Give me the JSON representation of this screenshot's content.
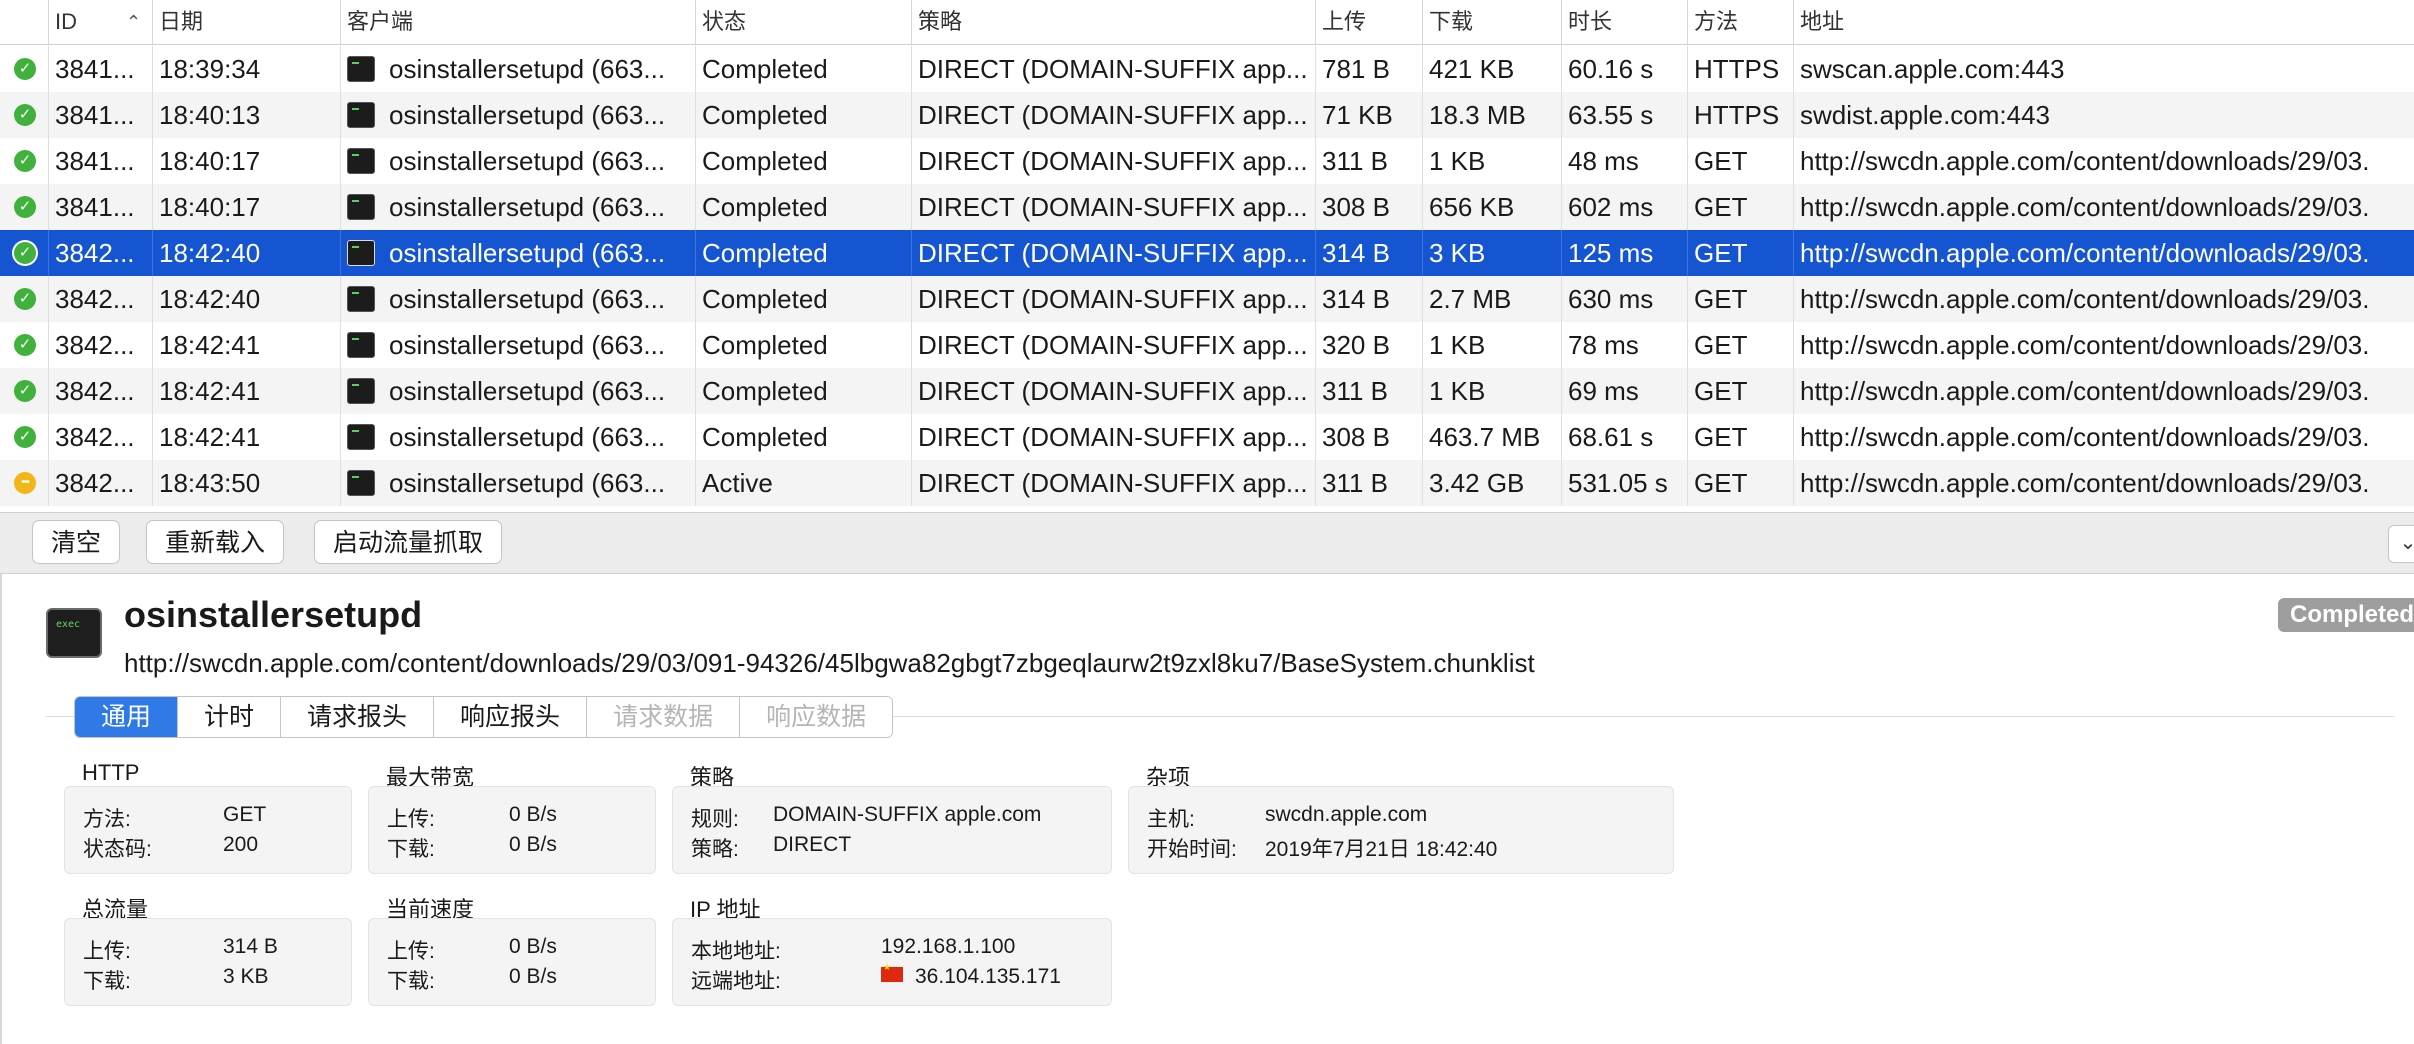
{
  "table": {
    "columns": [
      "ID",
      "日期",
      "客户端",
      "状态",
      "策略",
      "上传",
      "下载",
      "时长",
      "方法",
      "地址"
    ],
    "rows": [
      {
        "status": "done",
        "id": "3841...",
        "time": "18:39:34",
        "client": "osinstallersetupd (663...",
        "state": "Completed",
        "policy": "DIRECT (DOMAIN-SUFFIX app...",
        "upload": "781 B",
        "download": "421 KB",
        "duration": "60.16 s",
        "method": "HTTPS",
        "address": "swscan.apple.com:443"
      },
      {
        "status": "done",
        "id": "3841...",
        "time": "18:40:13",
        "client": "osinstallersetupd (663...",
        "state": "Completed",
        "policy": "DIRECT (DOMAIN-SUFFIX app...",
        "upload": "71 KB",
        "download": "18.3 MB",
        "duration": "63.55 s",
        "method": "HTTPS",
        "address": "swdist.apple.com:443"
      },
      {
        "status": "done",
        "id": "3841...",
        "time": "18:40:17",
        "client": "osinstallersetupd (663...",
        "state": "Completed",
        "policy": "DIRECT (DOMAIN-SUFFIX app...",
        "upload": "311 B",
        "download": "1 KB",
        "duration": "48 ms",
        "method": "GET",
        "address": "http://swcdn.apple.com/content/downloads/29/03."
      },
      {
        "status": "done",
        "id": "3841...",
        "time": "18:40:17",
        "client": "osinstallersetupd (663...",
        "state": "Completed",
        "policy": "DIRECT (DOMAIN-SUFFIX app...",
        "upload": "308 B",
        "download": "656 KB",
        "duration": "602 ms",
        "method": "GET",
        "address": "http://swcdn.apple.com/content/downloads/29/03."
      },
      {
        "status": "done",
        "id": "3842...",
        "time": "18:42:40",
        "client": "osinstallersetupd (663...",
        "state": "Completed",
        "policy": "DIRECT (DOMAIN-SUFFIX app...",
        "upload": "314 B",
        "download": "3 KB",
        "duration": "125 ms",
        "method": "GET",
        "address": "http://swcdn.apple.com/content/downloads/29/03.",
        "selected": true
      },
      {
        "status": "done",
        "id": "3842...",
        "time": "18:42:40",
        "client": "osinstallersetupd (663...",
        "state": "Completed",
        "policy": "DIRECT (DOMAIN-SUFFIX app...",
        "upload": "314 B",
        "download": "2.7 MB",
        "duration": "630 ms",
        "method": "GET",
        "address": "http://swcdn.apple.com/content/downloads/29/03."
      },
      {
        "status": "done",
        "id": "3842...",
        "time": "18:42:41",
        "client": "osinstallersetupd (663...",
        "state": "Completed",
        "policy": "DIRECT (DOMAIN-SUFFIX app...",
        "upload": "320 B",
        "download": "1 KB",
        "duration": "78 ms",
        "method": "GET",
        "address": "http://swcdn.apple.com/content/downloads/29/03."
      },
      {
        "status": "done",
        "id": "3842...",
        "time": "18:42:41",
        "client": "osinstallersetupd (663...",
        "state": "Completed",
        "policy": "DIRECT (DOMAIN-SUFFIX app...",
        "upload": "311 B",
        "download": "1 KB",
        "duration": "69 ms",
        "method": "GET",
        "address": "http://swcdn.apple.com/content/downloads/29/03."
      },
      {
        "status": "done",
        "id": "3842...",
        "time": "18:42:41",
        "client": "osinstallersetupd (663...",
        "state": "Completed",
        "policy": "DIRECT (DOMAIN-SUFFIX app...",
        "upload": "308 B",
        "download": "463.7 MB",
        "duration": "68.61 s",
        "method": "GET",
        "address": "http://swcdn.apple.com/content/downloads/29/03."
      },
      {
        "status": "active",
        "id": "3842...",
        "time": "18:43:50",
        "client": "osinstallersetupd (663...",
        "state": "Active",
        "policy": "DIRECT (DOMAIN-SUFFIX app...",
        "upload": "311 B",
        "download": "3.42 GB",
        "duration": "531.05 s",
        "method": "GET",
        "address": "http://swcdn.apple.com/content/downloads/29/03."
      }
    ]
  },
  "toolbar": {
    "clear": "清空",
    "reload": "重新载入",
    "capture": "启动流量抓取"
  },
  "detail": {
    "app_name": "osinstallersetupd",
    "app_icon_text": "exec",
    "url": "http://swcdn.apple.com/content/downloads/29/03/091-94326/45lbgwa82gbgt7zbgeqlaurw2t9zxl8ku7/BaseSystem.chunklist",
    "badge": "Completed",
    "tabs": [
      "通用",
      "计时",
      "请求报头",
      "响应报头",
      "请求数据",
      "响应数据"
    ],
    "http": {
      "title": "HTTP",
      "method_k": "方法:",
      "method_v": "GET",
      "code_k": "状态码:",
      "code_v": "200"
    },
    "bandwidth": {
      "title": "最大带宽",
      "up_k": "上传:",
      "up_v": "0 B/s",
      "down_k": "下载:",
      "down_v": "0 B/s"
    },
    "policy": {
      "title": "策略",
      "rule_k": "规则:",
      "rule_v": "DOMAIN-SUFFIX apple.com",
      "policy_k": "策略:",
      "policy_v": "DIRECT"
    },
    "misc": {
      "title": "杂项",
      "host_k": "主机:",
      "host_v": "swcdn.apple.com",
      "start_k": "开始时间:",
      "start_v": "2019年7月21日 18:42:40"
    },
    "total": {
      "title": "总流量",
      "up_k": "上传:",
      "up_v": "314 B",
      "down_k": "下载:",
      "down_v": "3 KB"
    },
    "speed": {
      "title": "当前速度",
      "up_k": "上传:",
      "up_v": "0 B/s",
      "down_k": "下载:",
      "down_v": "0 B/s"
    },
    "ip": {
      "title": "IP 地址",
      "local_k": "本地地址:",
      "local_v": "192.168.1.100",
      "remote_k": "远端地址:",
      "remote_v": "36.104.135.171"
    }
  },
  "colors": {
    "selection": "#1555d2",
    "tab_active": "#2f7ae6",
    "status_done": "#3fb13c",
    "status_active": "#f2b619",
    "badge": "#9e9e9e"
  }
}
